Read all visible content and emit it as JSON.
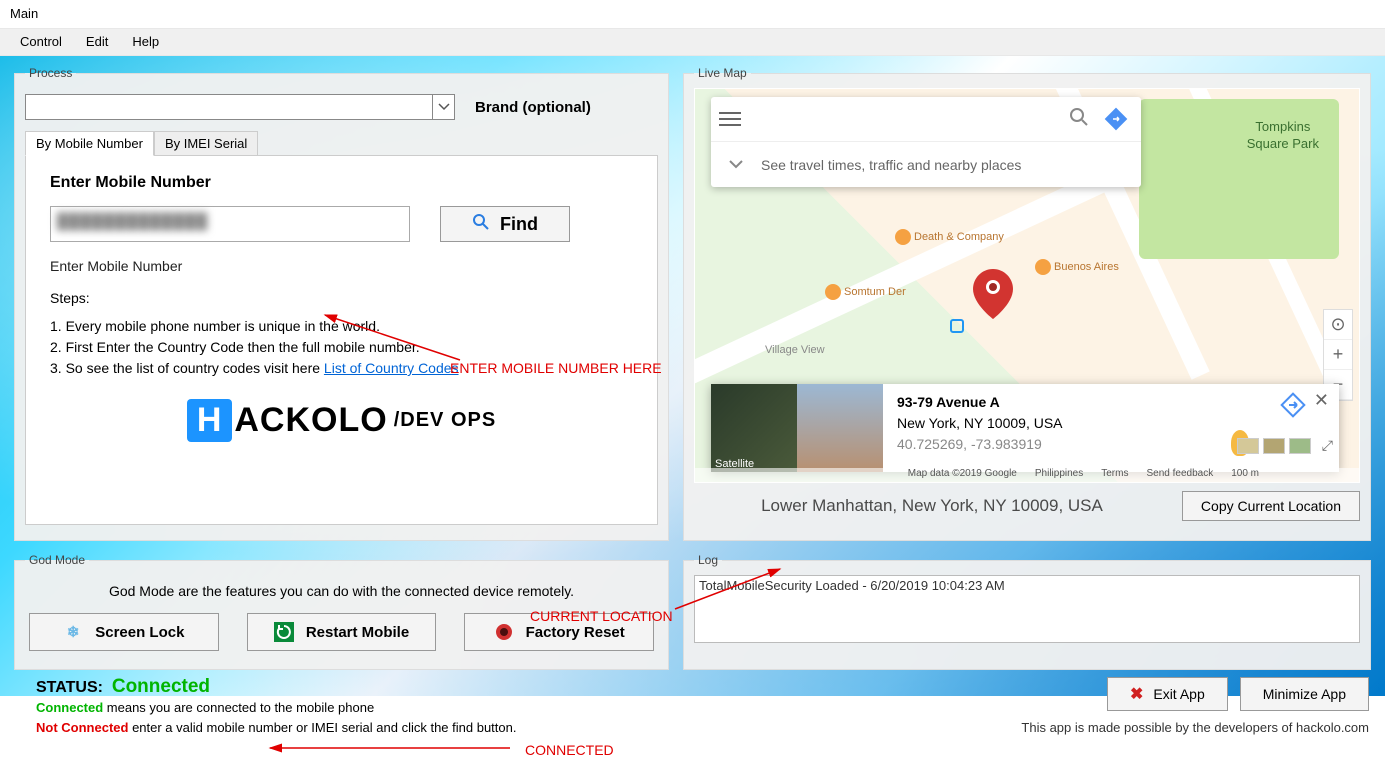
{
  "window_title": "Main",
  "menu": {
    "control": "Control",
    "edit": "Edit",
    "help": "Help"
  },
  "process": {
    "legend": "Process",
    "brand_label": "Brand (optional)",
    "tab1": "By Mobile Number",
    "tab2": "By IMEI Serial",
    "enter_label": "Enter Mobile Number",
    "find_label": "Find",
    "hint": "Enter Mobile  Number",
    "steps_label": "Steps:",
    "step1": "1. Every mobile phone number is unique in the world.",
    "step2": "2. First Enter the Country Code then the full mobile number.",
    "step3_a": "3. So see the list of country codes visit here  ",
    "step3_link": "List of Country Codes",
    "logo_text": "ACKOLO",
    "logo_dev": "/DEV OPS"
  },
  "god": {
    "legend": "God Mode",
    "desc": "God Mode are the features you can do with the connected device remotely.",
    "btn1": "Screen Lock",
    "btn2": "Restart Mobile",
    "btn3": "Factory Reset"
  },
  "map": {
    "legend": "Live Map",
    "search_hint": "See travel times, traffic and nearby places",
    "park": "Tompkins\nSquare Park",
    "poi1": "Death & Company",
    "poi2": "Buenos Aires",
    "poi3": "Somtum Der",
    "poi4": "Village View",
    "addr1": "93-79 Avenue A",
    "addr2": "New York, NY 10009, USA",
    "coords": "40.725269, -73.983919",
    "sat": "Satellite",
    "meta1": "Map data ©2019 Google",
    "meta2": "Philippines",
    "meta3": "Terms",
    "meta4": "Send feedback",
    "meta5": "100 m",
    "location": "Lower Manhattan, New York, NY 10009, USA",
    "copy_btn": "Copy Current Location"
  },
  "log": {
    "legend": "Log",
    "entry": "TotalMobileSecurity Loaded - 6/20/2019 10:04:23 AM"
  },
  "status": {
    "label": "STATUS:",
    "value": "Connected",
    "help_c": "Connected",
    "help_c_txt": "  means you are connected to the mobile phone",
    "help_nc": "Not Connected",
    "help_nc_txt": "  enter a valid mobile number or IMEI serial and click the find button."
  },
  "footer": {
    "exit": "Exit App",
    "minimize": "Minimize App",
    "credit": "This app is made possible by the developers of hackolo.com"
  },
  "annotations": {
    "a1": "ENTER MOBILE NUMBER HERE",
    "a2": "CURRENT LOCATION",
    "a3": "CONNECTED"
  }
}
